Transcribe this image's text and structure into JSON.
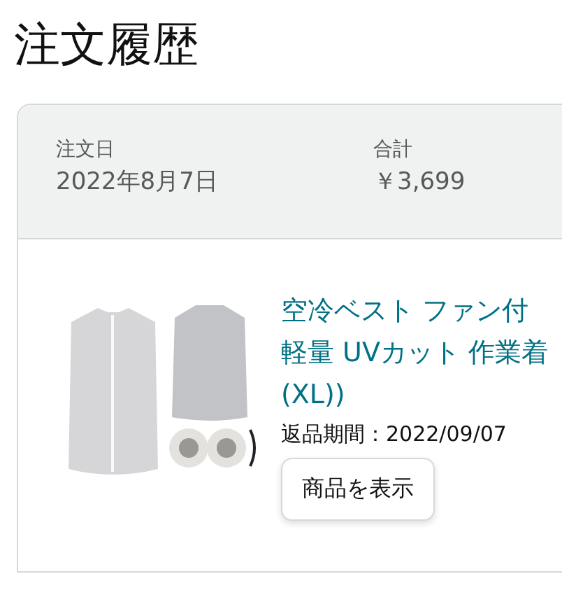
{
  "page_title": "注文履歴",
  "order": {
    "date_label": "注文日",
    "date": "2022年8月7日",
    "total_label": "合計",
    "total": "￥3,699",
    "items": [
      {
        "title_lines": [
          "空冷ベスト ファン付",
          "軽量 UVカット 作業着",
          "(XL))"
        ],
        "return_period": "返品期間：2022/09/07",
        "button": "商品を表示"
      }
    ]
  }
}
